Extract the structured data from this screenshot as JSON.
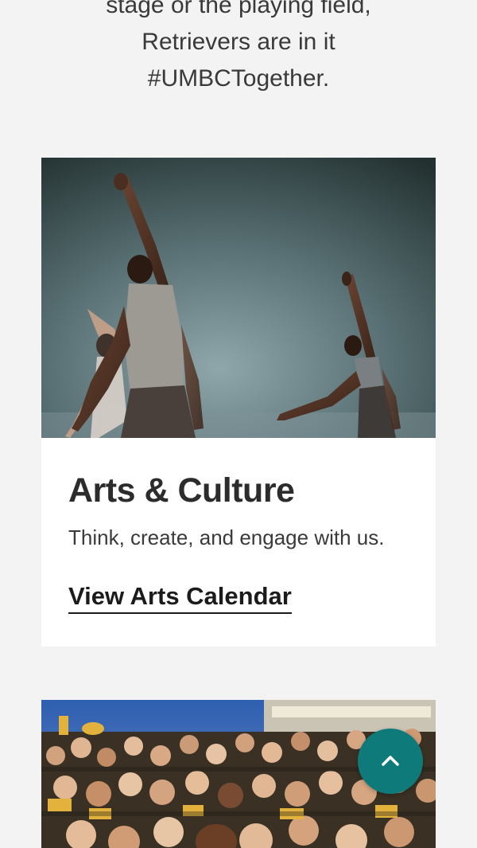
{
  "intro": {
    "lines": [
      "stage or the playing field,",
      "Retrievers are in it",
      "#UMBCTogether."
    ]
  },
  "arts_card": {
    "image_alt": "Dancers performing on stage",
    "title": "Arts & Culture",
    "text": "Think, create, and engage with us.",
    "link_label": "View Arts Calendar"
  },
  "fans_card": {
    "image_alt": "Crowd of fans cheering in stadium stands"
  },
  "back_to_top": {
    "icon": "chevron-up-icon",
    "color": "#0f7a7a"
  }
}
